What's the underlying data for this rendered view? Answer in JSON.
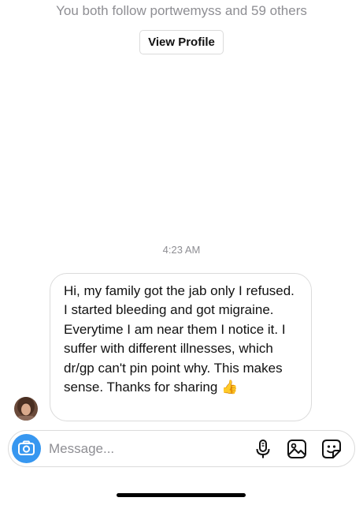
{
  "profile": {
    "mutual_followers_text": "You both follow portwemyss and 59 others",
    "view_profile_label": "View Profile"
  },
  "thread": {
    "timestamp": "4:23 AM",
    "messages": [
      {
        "sender": "other",
        "text": "Hi, my family got the jab only I refused. I started bleeding and got migraine. Everytime I am near them I notice it. I suffer with different illnesses, which dr/gp can't pin point why. This makes sense. Thanks for sharing 👍"
      }
    ]
  },
  "composer": {
    "placeholder": "Message...",
    "icons": [
      "camera-icon",
      "microphone-icon",
      "gallery-icon",
      "sticker-icon"
    ]
  },
  "colors": {
    "accent": "#3797f0",
    "secondary_text": "#8e8e93",
    "border": "#dbdbdb",
    "thumbs_up": "#f2b62f"
  }
}
